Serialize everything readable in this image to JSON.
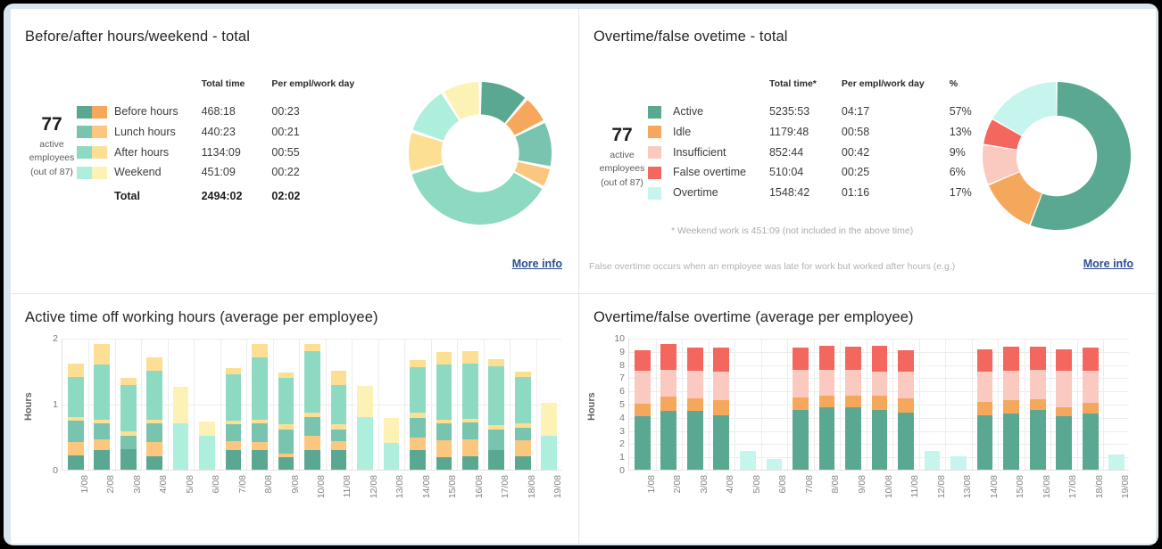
{
  "colors": {
    "green_dark": "#5aa891",
    "green_mid": "#79c4ae",
    "green_light": "#8ed9c1",
    "green_pale": "#aeeedd",
    "green_paler": "#bdf0e4",
    "cyan_pale": "#c6f5ee",
    "orange": "#f5a85b",
    "orange_light": "#fbc77e",
    "yellow": "#fcdf93",
    "yellow_pale": "#fdf2b6",
    "pink_light": "#fac9c0",
    "red": "#f4675f",
    "link": "#2b4f92",
    "frame": "#dbe5ee",
    "divider": "#e3e6e8"
  },
  "panel_top_left": {
    "title": "Before/after hours/weekend - total",
    "employees": {
      "count": "77",
      "line1": "active",
      "line2": "employees",
      "line3": "(out of 87)"
    },
    "table": {
      "headers": [
        "",
        "",
        "Total time",
        "Per empl/work day"
      ],
      "rows": [
        {
          "swatch_a": "#5aa891",
          "swatch_b": "#f5a85b",
          "label": "Before hours",
          "total_time": "468:18",
          "per_day": "00:23"
        },
        {
          "swatch_a": "#79c4ae",
          "swatch_b": "#fbc77e",
          "label": "Lunch hours",
          "total_time": "440:23",
          "per_day": "00:21"
        },
        {
          "swatch_a": "#8ed9c1",
          "swatch_b": "#fcdf93",
          "label": "After hours",
          "total_time": "1134:09",
          "per_day": "00:55"
        },
        {
          "swatch_a": "#aeeedd",
          "swatch_b": "#fdf2b6",
          "label": "Weekend",
          "total_time": "451:09",
          "per_day": "00:22"
        }
      ],
      "total_row": {
        "label": "Total",
        "total_time": "2494:02",
        "per_day": "02:02"
      }
    },
    "more_info": "More info",
    "chart_data": {
      "type": "pie",
      "title": "Before/after hours/weekend - total",
      "legend_position": "left",
      "labels": [
        "Before hours (A)",
        "Before hours (B)",
        "Lunch hours (A)",
        "Lunch hours (B)",
        "After hours (A)",
        "After hours (B)",
        "Weekend (A)",
        "Weekend (B)"
      ],
      "colors": [
        "#5aa891",
        "#f5a85b",
        "#79c4ae",
        "#fbc77e",
        "#8ed9c1",
        "#fcdf93",
        "#aeeedd",
        "#fdf2b6"
      ],
      "values": [
        9.5,
        5.5,
        9.0,
        4.0,
        32.0,
        8.0,
        9.5,
        7.5
      ]
    }
  },
  "panel_top_right": {
    "title": "Overtime/false ovetime - total",
    "employees": {
      "count": "77",
      "line1": "active",
      "line2": "employees",
      "line3": "(out of 87)"
    },
    "table": {
      "headers": [
        "",
        "Total time*",
        "Per empl/work day",
        "%"
      ],
      "rows": [
        {
          "swatch": "#5aa891",
          "label": "Active",
          "total_time": "5235:53",
          "per_day": "04:17",
          "pct": "57%"
        },
        {
          "swatch": "#f5a85b",
          "label": "Idle",
          "total_time": "1179:48",
          "per_day": "00:58",
          "pct": "13%"
        },
        {
          "swatch": "#fac9c0",
          "label": "Insufficient",
          "total_time": "852:44",
          "per_day": "00:42",
          "pct": "9%"
        },
        {
          "swatch": "#f4675f",
          "label": "False overtime",
          "total_time": "510:04",
          "per_day": "00:25",
          "pct": "6%"
        },
        {
          "swatch": "#c6f5ee",
          "label": "Overtime",
          "total_time": "1548:42",
          "per_day": "01:16",
          "pct": "17%"
        }
      ]
    },
    "note": "* Weekend work is 451:09 (not included in the above time)",
    "footnote": "False overtime occurs when an employee was late for work but worked after hours (e.g.)",
    "more_info": "More info",
    "chart_data": {
      "type": "pie",
      "title": "Overtime/false ovetime - total",
      "legend_position": "left",
      "labels": [
        "Active",
        "Idle",
        "Insufficient",
        "False overtime",
        "Overtime"
      ],
      "colors": [
        "#5aa891",
        "#f5a85b",
        "#fac9c0",
        "#f4675f",
        "#c6f5ee"
      ],
      "values": [
        57,
        13,
        9,
        6,
        17
      ],
      "unit": "%"
    }
  },
  "panel_bottom_left": {
    "title": "Active time off working hours (average per employee)",
    "chart_data": {
      "type": "bar",
      "stacked": true,
      "title": "Active time off working hours (average per employee)",
      "xlabel": "",
      "ylabel": "Hours",
      "ylim": [
        0,
        2
      ],
      "yticks": [
        0,
        1,
        2
      ],
      "grid": true,
      "categories": [
        "1/08",
        "2/08",
        "3/08",
        "4/08",
        "5/08",
        "6/08",
        "7/08",
        "8/08",
        "9/08",
        "10/08",
        "11/08",
        "12/08",
        "13/08",
        "14/08",
        "15/08",
        "16/08",
        "17/08",
        "18/08",
        "19/08"
      ],
      "series": [
        {
          "name": "Before hours",
          "color": "#5aa891",
          "values": [
            0.22,
            0.3,
            0.31,
            0.2,
            0.0,
            0.0,
            0.3,
            0.3,
            0.19,
            0.3,
            0.3,
            0.0,
            0.0,
            0.3,
            0.19,
            0.2,
            0.3,
            0.2,
            0.0
          ]
        },
        {
          "name": "Before hours (idle)",
          "color": "#fbc77e",
          "values": [
            0.2,
            0.16,
            0.0,
            0.22,
            0.0,
            0.0,
            0.13,
            0.12,
            0.06,
            0.22,
            0.13,
            0.0,
            0.0,
            0.19,
            0.26,
            0.26,
            0.0,
            0.25,
            0.0
          ]
        },
        {
          "name": "Lunch hours",
          "color": "#79c4ae",
          "values": [
            0.32,
            0.24,
            0.21,
            0.28,
            0.0,
            0.0,
            0.26,
            0.28,
            0.36,
            0.28,
            0.18,
            0.0,
            0.0,
            0.3,
            0.25,
            0.25,
            0.31,
            0.19,
            0.0
          ]
        },
        {
          "name": "Lunch hours (idle)",
          "color": "#fcdf93",
          "values": [
            0.06,
            0.06,
            0.06,
            0.06,
            0.0,
            0.0,
            0.06,
            0.06,
            0.08,
            0.06,
            0.08,
            0.0,
            0.0,
            0.07,
            0.06,
            0.06,
            0.06,
            0.06,
            0.0
          ]
        },
        {
          "name": "After hours",
          "color": "#8ed9c1",
          "values": [
            0.6,
            0.84,
            0.7,
            0.74,
            0.0,
            0.0,
            0.7,
            0.94,
            0.7,
            0.94,
            0.6,
            0.0,
            0.0,
            0.7,
            0.84,
            0.84,
            0.9,
            0.7,
            0.0
          ]
        },
        {
          "name": "After hours (idle)",
          "color": "#fcdf93",
          "values": [
            0.2,
            0.3,
            0.1,
            0.2,
            0.0,
            0.0,
            0.08,
            0.2,
            0.08,
            0.1,
            0.2,
            0.0,
            0.0,
            0.1,
            0.18,
            0.18,
            0.1,
            0.08,
            0.0
          ]
        },
        {
          "name": "Weekend",
          "color": "#aeeedd",
          "values": [
            0.0,
            0.0,
            0.0,
            0.0,
            0.7,
            0.52,
            0.0,
            0.0,
            0.0,
            0.0,
            0.0,
            0.8,
            0.4,
            0.0,
            0.0,
            0.0,
            0.0,
            0.0,
            0.52
          ]
        },
        {
          "name": "Weekend (idle)",
          "color": "#fdf2b6",
          "values": [
            0.0,
            0.0,
            0.0,
            0.0,
            0.55,
            0.2,
            0.0,
            0.0,
            0.0,
            0.0,
            0.0,
            0.46,
            0.38,
            0.0,
            0.0,
            0.0,
            0.0,
            0.0,
            0.48
          ]
        }
      ]
    }
  },
  "panel_bottom_right": {
    "title": "Overtime/false overtime (average per employee)",
    "chart_data": {
      "type": "bar",
      "stacked": true,
      "title": "Overtime/false overtime (average per employee)",
      "xlabel": "",
      "ylabel": "Hours",
      "ylim": [
        0,
        10
      ],
      "yticks": [
        0,
        1,
        2,
        3,
        4,
        5,
        6,
        7,
        8,
        9,
        10
      ],
      "grid": true,
      "categories": [
        "1/08",
        "2/08",
        "3/08",
        "4/08",
        "5/08",
        "6/08",
        "7/08",
        "8/08",
        "9/08",
        "10/08",
        "11/08",
        "12/08",
        "13/08",
        "14/08",
        "15/08",
        "16/08",
        "17/08",
        "18/08",
        "19/08"
      ],
      "series": [
        {
          "name": "Active",
          "color": "#5aa891",
          "values": [
            4.05,
            4.45,
            4.45,
            4.15,
            0.0,
            0.0,
            4.5,
            4.7,
            4.7,
            4.55,
            4.35,
            0.0,
            0.0,
            4.15,
            4.25,
            4.5,
            4.05,
            4.25,
            0.0
          ]
        },
        {
          "name": "Idle",
          "color": "#f5a85b",
          "values": [
            0.95,
            1.1,
            0.95,
            1.1,
            0.0,
            0.0,
            1.0,
            0.9,
            0.9,
            1.05,
            1.05,
            0.0,
            0.0,
            1.0,
            1.05,
            0.85,
            0.7,
            0.85,
            0.0
          ]
        },
        {
          "name": "Insufficient",
          "color": "#fac9c0",
          "values": [
            2.5,
            2.05,
            2.1,
            2.2,
            0.0,
            0.0,
            2.05,
            2.0,
            2.0,
            1.85,
            2.05,
            0.0,
            0.0,
            2.25,
            2.2,
            2.2,
            2.75,
            2.4,
            0.0
          ]
        },
        {
          "name": "False overtime",
          "color": "#f4675f",
          "values": [
            1.5,
            1.9,
            1.7,
            1.8,
            0.0,
            0.0,
            1.65,
            1.75,
            1.7,
            1.9,
            1.55,
            0.0,
            0.0,
            1.7,
            1.8,
            1.75,
            1.6,
            1.7,
            0.0
          ]
        },
        {
          "name": "Overtime",
          "color": "#c6f5ee",
          "values": [
            0.0,
            0.0,
            0.0,
            0.0,
            1.35,
            0.75,
            0.0,
            0.0,
            0.0,
            0.0,
            0.0,
            1.35,
            1.0,
            0.0,
            0.0,
            0.0,
            0.0,
            0.0,
            1.08
          ]
        }
      ]
    }
  }
}
